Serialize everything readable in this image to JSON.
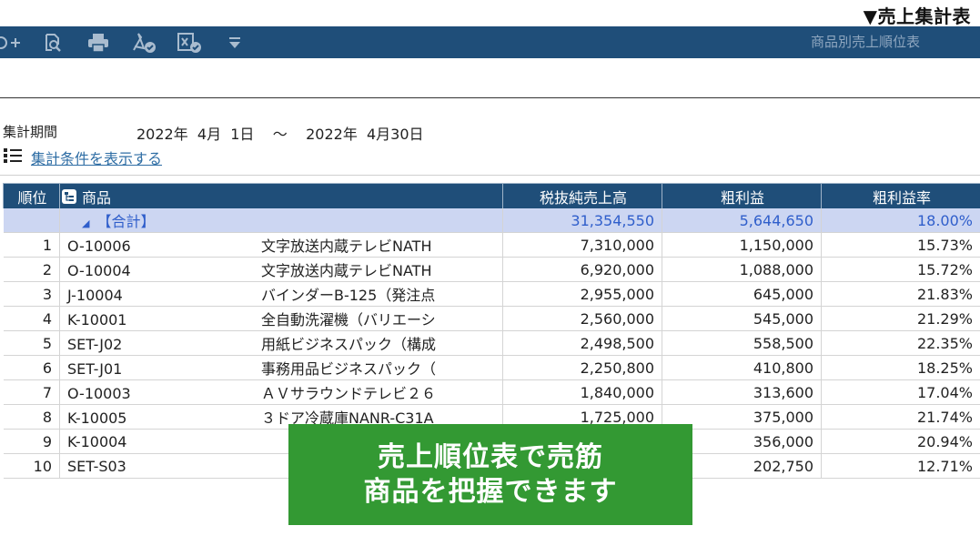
{
  "caption": "▼売上集計表",
  "toolbar": {
    "icons": [
      "search-add-icon",
      "zoom-search-icon",
      "print-icon",
      "pdf-check-icon",
      "excel-check-icon",
      "dropdown-icon"
    ],
    "report_name": "商品別売上順位表"
  },
  "period": {
    "label": "集計期間",
    "value": "2022年  4月  1日    ～    2022年  4月30日"
  },
  "conditions_link": "集計条件を表示する",
  "table": {
    "headers": {
      "rank": "順位",
      "product": "商品",
      "sales": "税抜純売上高",
      "profit": "粗利益",
      "margin": "粗利益率"
    },
    "total": {
      "label": "【合計】",
      "sales": "31,354,550",
      "profit": "5,644,650",
      "margin": "18.00%"
    },
    "rows": [
      {
        "rank": "1",
        "code": "O-10006",
        "name": "文字放送内蔵テレビNATH",
        "sales": "7,310,000",
        "profit": "1,150,000",
        "margin": "15.73%"
      },
      {
        "rank": "2",
        "code": "O-10004",
        "name": "文字放送内蔵テレビNATH",
        "sales": "6,920,000",
        "profit": "1,088,000",
        "margin": "15.72%"
      },
      {
        "rank": "3",
        "code": "J-10004",
        "name": "バインダーB-125（発注点",
        "sales": "2,955,000",
        "profit": "645,000",
        "margin": "21.83%"
      },
      {
        "rank": "4",
        "code": "K-10001",
        "name": "全自動洗濯機（バリエーシ",
        "sales": "2,560,000",
        "profit": "545,000",
        "margin": "21.29%"
      },
      {
        "rank": "5",
        "code": "SET-J02",
        "name": "用紙ビジネスパック（構成",
        "sales": "2,498,500",
        "profit": "558,500",
        "margin": "22.35%"
      },
      {
        "rank": "6",
        "code": "SET-J01",
        "name": "事務用品ビジネスパック（",
        "sales": "2,250,800",
        "profit": "410,800",
        "margin": "18.25%"
      },
      {
        "rank": "7",
        "code": "O-10003",
        "name": "ＡＶサラウンドテレビ２６",
        "sales": "1,840,000",
        "profit": "313,600",
        "margin": "17.04%"
      },
      {
        "rank": "8",
        "code": "K-10005",
        "name": "３ドア冷蔵庫NANR-C31A",
        "sales": "1,725,000",
        "profit": "375,000",
        "margin": "21.74%"
      },
      {
        "rank": "9",
        "code": "K-10004",
        "name": "",
        "sales": "",
        "profit": "356,000",
        "margin": "20.94%"
      },
      {
        "rank": "10",
        "code": "SET-S03",
        "name": "",
        "sales": "",
        "profit": "202,750",
        "margin": "12.71%"
      }
    ]
  },
  "banner": {
    "line1": "売上順位表で売筋",
    "line2": "商品を把握できます"
  },
  "colors": {
    "toolbar_bg": "#1f4e79",
    "total_row_bg": "#ccd6f2",
    "total_text": "#2f5ecb",
    "link": "#2e6da4",
    "banner_bg": "#339933"
  }
}
